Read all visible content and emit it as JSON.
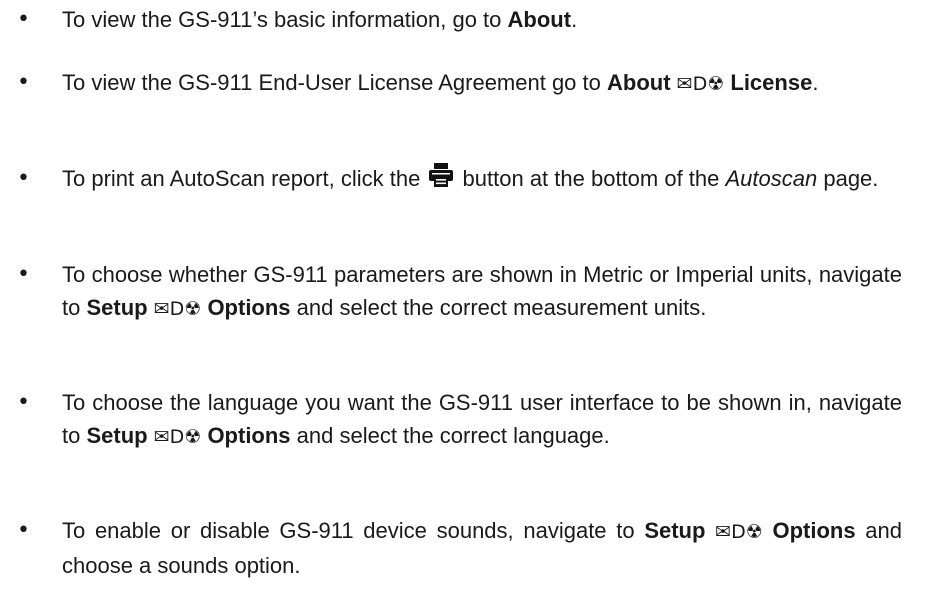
{
  "items": [
    {
      "pre": "To view the GS-911’s basic information, go to ",
      "b1": "About",
      "post": "."
    },
    {
      "pre": "To view the GS-911 End-User License Agreement go to ",
      "b1": "About",
      "sym": "✉D☢",
      "b2": "License",
      "post": "."
    },
    {
      "pre": "To print an AutoScan report, click the ",
      "icon": "printer-icon",
      "mid": " button at the bottom of the ",
      "it": "Autoscan",
      "post": " page."
    },
    {
      "pre": "To choose whether GS-911 parameters are shown in Metric or Imperial units, navigate to ",
      "b1": "Setup",
      "sym": "✉D☢",
      "b2": "Options",
      "post": " and select the correct measurement units."
    },
    {
      "pre": "To choose the language you want the GS-911 user interface to be shown in, navigate to ",
      "b1": "Setup",
      "sym": "✉D☢",
      "b2": "Options",
      "post": " and select the correct language."
    },
    {
      "pre": "To enable or disable GS-911 device sounds, navigate to ",
      "b1": "Setup",
      "sym": "✉D☢",
      "b2": "Options",
      "post": " and choose a sounds option."
    }
  ],
  "bullet": "•"
}
